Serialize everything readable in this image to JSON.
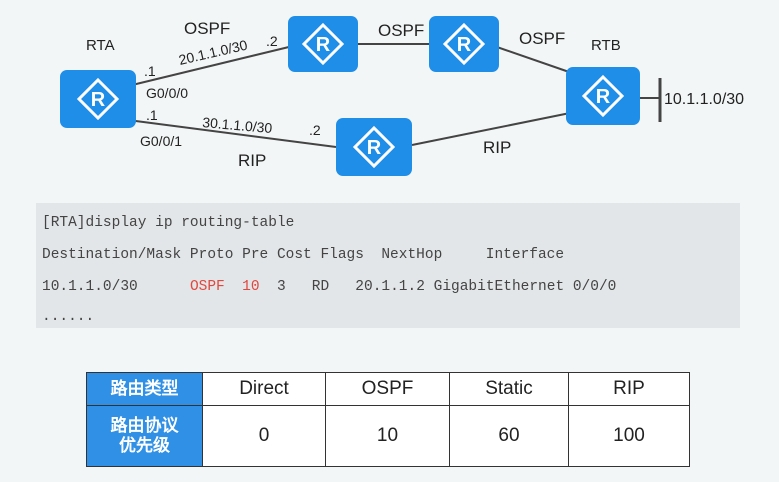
{
  "topology": {
    "routers": {
      "rta": "RTA",
      "rtb": "RTB"
    },
    "router_icon_letter": "R",
    "labels": {
      "ospf_1": "OSPF",
      "ospf_2": "OSPF",
      "ospf_3": "OSPF",
      "rip_1": "RIP",
      "rip_2": "RIP",
      "net_upper": "20.1.1.0/30",
      "net_lower": "30.1.1.0/30",
      "net_rtb": "10.1.1.0/30",
      "rta_upper_host": ".1",
      "rta_lower_host": ".1",
      "rta_upper_if": "G0/0/0",
      "rta_lower_if": "G0/0/1",
      "peer_upper_host": ".2",
      "peer_lower_host": ".2"
    }
  },
  "cli": {
    "command": "[RTA]display ip routing-table",
    "header": "Destination/Mask Proto Pre Cost Flags  NextHop     Interface",
    "row": {
      "dest": "10.1.1.0/30",
      "proto": "OSPF",
      "pre": "10",
      "cost": "3",
      "flags": "RD",
      "nexthop": "20.1.1.2",
      "iface": "GigabitEthernet 0/0/0"
    },
    "ellipsis": "......"
  },
  "table": {
    "row1_head": "路由类型",
    "row2_head_l1": "路由协议",
    "row2_head_l2": "优先级",
    "types": [
      "Direct",
      "OSPF",
      "Static",
      "RIP"
    ],
    "priorities": [
      "0",
      "10",
      "60",
      "100"
    ]
  },
  "colors": {
    "router_fill": "#1f8ee8",
    "table_head": "#2f90e6",
    "highlight": "#e0483f"
  }
}
